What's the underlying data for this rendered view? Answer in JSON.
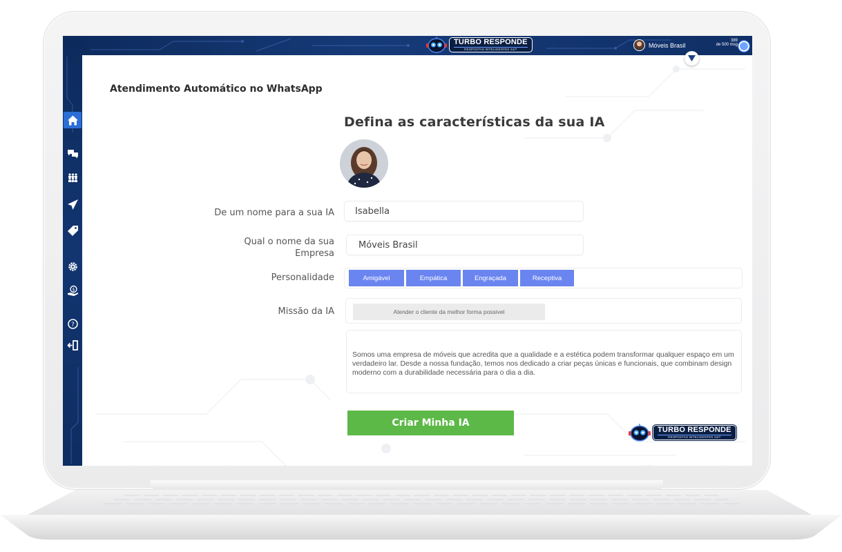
{
  "header": {
    "brand_title": "TURBO RESPONDE",
    "brand_subtitle": "RESPOSTAS INTELIGENTES 24/7",
    "company_name": "Móveis Brasil",
    "message_used": "389",
    "message_total": "de 500 msg"
  },
  "sidebar": {
    "items": [
      {
        "icon": "home-icon",
        "active": true
      },
      {
        "icon": "chat-icon"
      },
      {
        "icon": "contacts-icon"
      },
      {
        "icon": "send-icon"
      },
      {
        "icon": "tag-icon"
      },
      {
        "icon": "settings-icon"
      },
      {
        "icon": "payment-icon"
      },
      {
        "icon": "help-icon"
      },
      {
        "icon": "logout-icon"
      }
    ]
  },
  "page": {
    "title": "Atendimento Automático no WhatsApp",
    "section_title": "Defina as características da sua IA"
  },
  "form": {
    "ai_name_label": "De um nome para a sua IA",
    "ai_name_value": "Isabella",
    "company_label_line1": "Qual o nome da sua",
    "company_label_line2": "Empresa",
    "company_value": "Móveis Brasil",
    "personality_label": "Personalidade",
    "personality_options": [
      "Amigável",
      "Empática",
      "Engraçada",
      "Receptiva"
    ],
    "mission_label": "Missão da IA",
    "mission_value": "Atender o cliente da melhor forma possivel",
    "description": "Somos uma empresa de móveis que acredita que a qualidade e a estética podem transformar qualquer espaço em um verdadeiro lar. Desde a nossa fundação, temos nos dedicado a criar peças únicas e funcionais, que combinam design moderno com a durabilidade necessária para o dia a dia.",
    "submit_label": "Criar Minha IA"
  },
  "footer_brand": {
    "title": "TURBO RESPONDE",
    "subtitle": "RESPOSTAS INTELIGENTES 24/7"
  },
  "colors": {
    "nav_dark": "#0d2a5c",
    "active_icon": "#2b6ed6",
    "chip": "#6a85f0",
    "submit": "#5cb847"
  }
}
